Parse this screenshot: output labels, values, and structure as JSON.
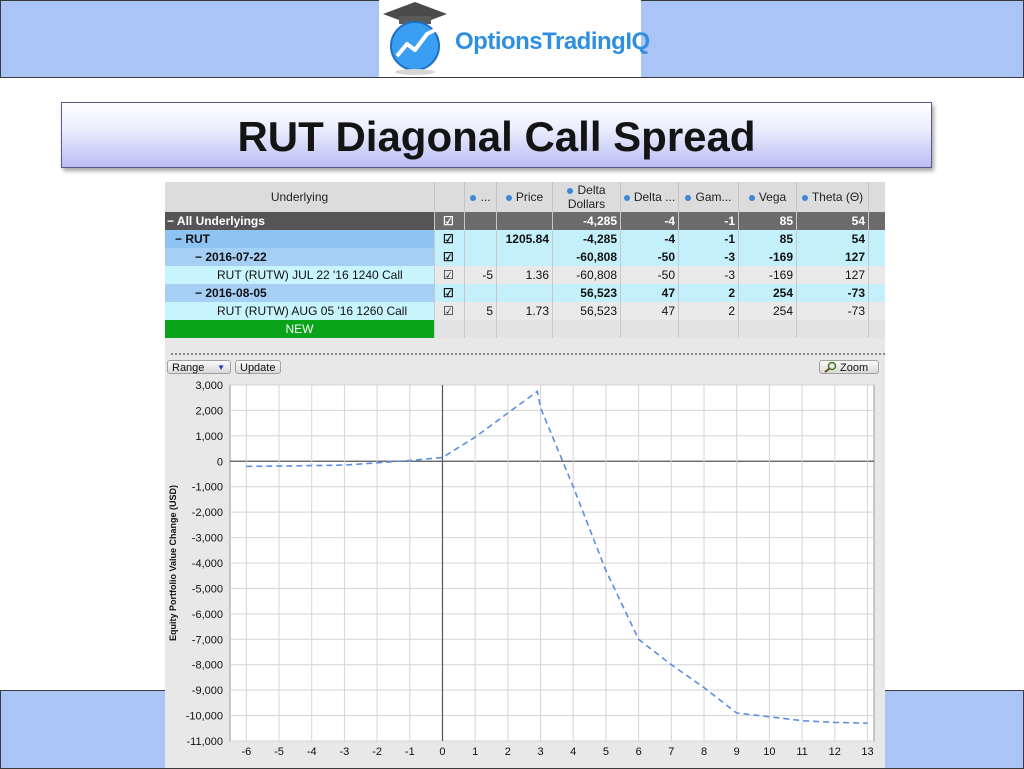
{
  "slide": {
    "title": "RUT Diagonal Call Spread",
    "logo_text": "OptionsTrading",
    "logo_iq": "IQ",
    "colors": {
      "band": "#a9c4f5",
      "title_grad_end": "#b9bdf4"
    }
  },
  "table": {
    "headers": {
      "underlying": "Underlying",
      "qty": "...",
      "price": "Price",
      "delta_dollars_1": "Delta",
      "delta_dollars_2": "Dollars",
      "delta": "Delta ...",
      "gamma": "Gam...",
      "vega": "Vega",
      "theta": "Theta (Θ)"
    },
    "rows": [
      {
        "label": "− All Underlyings",
        "check": "☑",
        "qty": "",
        "price": "",
        "delta_dollars": "-4,285",
        "delta": "-4",
        "gamma": "-1",
        "vega": "85",
        "theta": "54"
      },
      {
        "label": "− RUT",
        "check": "☑",
        "qty": "",
        "price": "1205.84",
        "delta_dollars": "-4,285",
        "delta": "-4",
        "gamma": "-1",
        "vega": "85",
        "theta": "54"
      },
      {
        "label": "− 2016-07-22",
        "check": "☑",
        "qty": "",
        "price": "",
        "delta_dollars": "-60,808",
        "delta": "-50",
        "gamma": "-3",
        "vega": "-169",
        "theta": "127"
      },
      {
        "label": "RUT (RUTW) JUL 22 '16 1240 Call",
        "check": "☑",
        "qty": "-5",
        "price": "1.36",
        "delta_dollars": "-60,808",
        "delta": "-50",
        "gamma": "-3",
        "vega": "-169",
        "theta": "127"
      },
      {
        "label": "− 2016-08-05",
        "check": "☑",
        "qty": "",
        "price": "",
        "delta_dollars": "56,523",
        "delta": "47",
        "gamma": "2",
        "vega": "254",
        "theta": "-73"
      },
      {
        "label": "RUT (RUTW) AUG 05 '16 1260 Call",
        "check": "☑",
        "qty": "5",
        "price": "1.73",
        "delta_dollars": "56,523",
        "delta": "47",
        "gamma": "2",
        "vega": "254",
        "theta": "-73"
      },
      {
        "label": "NEW",
        "check": "",
        "qty": "",
        "price": "",
        "delta_dollars": "",
        "delta": "",
        "gamma": "",
        "vega": "",
        "theta": ""
      }
    ]
  },
  "toolbar": {
    "range_label": "Range",
    "range_arrow": "▼",
    "update_label": "Update",
    "zoom_label": "Zoom",
    "zoom_icon": "magnifier-icon"
  },
  "chart_data": {
    "type": "line",
    "title": "",
    "ylabel": "Equity Portfolio Value Change (USD)",
    "xlabel": "",
    "xlim": [
      -6.5,
      13.2
    ],
    "ylim": [
      -11000,
      3000
    ],
    "xticks": [
      -6,
      -5,
      -4,
      -3,
      -2,
      -1,
      0,
      1,
      2,
      3,
      4,
      5,
      6,
      7,
      8,
      9,
      10,
      11,
      12,
      13
    ],
    "yticks": [
      3000,
      2000,
      1000,
      0,
      -1000,
      -2000,
      -3000,
      -4000,
      -5000,
      -6000,
      -7000,
      -8000,
      -9000,
      -10000,
      -11000
    ],
    "ytick_labels": [
      "3,000",
      "2,000",
      "1,000",
      "0",
      "-1,000",
      "-2,000",
      "-3,000",
      "-4,000",
      "-5,000",
      "-6,000",
      "-7,000",
      "-8,000",
      "-9,000",
      "-10,000",
      "-11,000"
    ],
    "grid": true,
    "line_style": "dashed",
    "line_color": "#5b8fe0",
    "series": [
      {
        "x": [
          -6,
          -5,
          -4,
          -3,
          -2,
          -1,
          0,
          1,
          2,
          2.9,
          3,
          4,
          5,
          6,
          7,
          8,
          9,
          10,
          11,
          12,
          13
        ],
        "values": [
          -200,
          -190,
          -170,
          -150,
          -60,
          30,
          150,
          950,
          1900,
          2750,
          2100,
          -1000,
          -4300,
          -7000,
          -8000,
          -8900,
          -9900,
          -10050,
          -10200,
          -10270,
          -10300
        ]
      }
    ]
  }
}
